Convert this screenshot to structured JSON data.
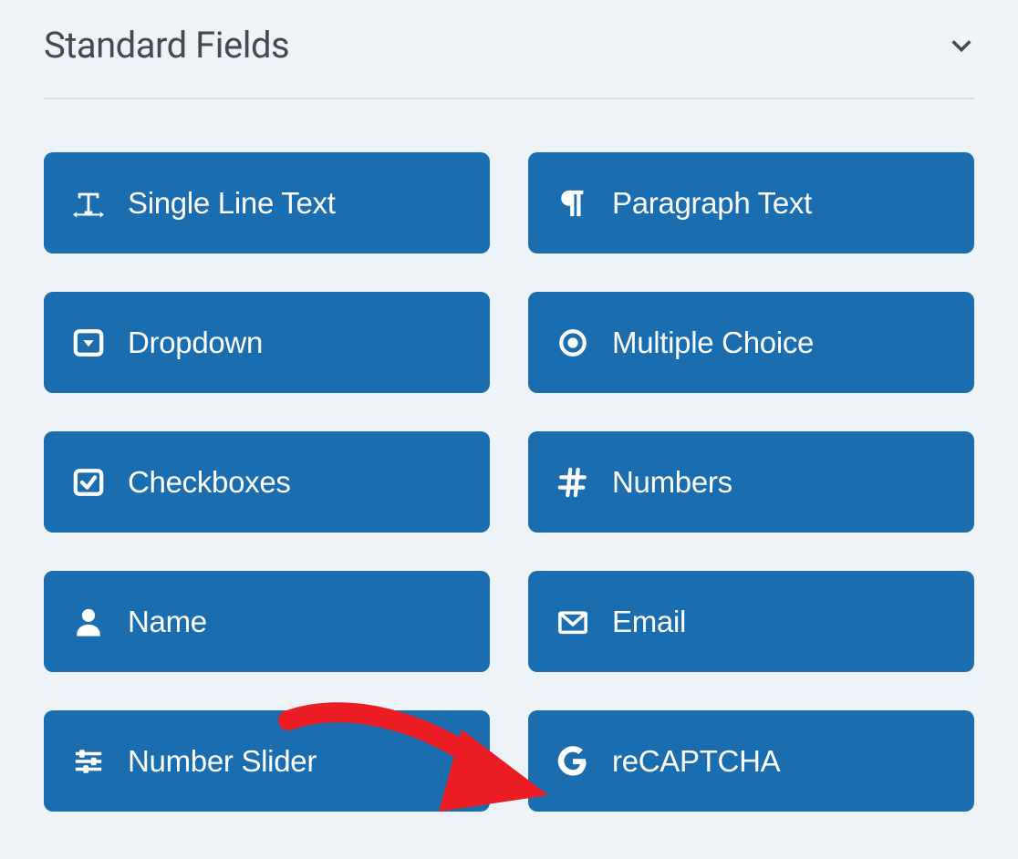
{
  "section": {
    "title": "Standard Fields"
  },
  "fields": [
    {
      "icon": "text-icon",
      "label": "Single Line Text"
    },
    {
      "icon": "paragraph-icon",
      "label": "Paragraph Text"
    },
    {
      "icon": "dropdown-icon",
      "label": "Dropdown"
    },
    {
      "icon": "radio-icon",
      "label": "Multiple Choice"
    },
    {
      "icon": "checkbox-icon",
      "label": "Checkboxes"
    },
    {
      "icon": "hash-icon",
      "label": "Numbers"
    },
    {
      "icon": "user-icon",
      "label": "Name"
    },
    {
      "icon": "envelope-icon",
      "label": "Email"
    },
    {
      "icon": "sliders-icon",
      "label": "Number Slider"
    },
    {
      "icon": "google-icon",
      "label": "reCAPTCHA"
    }
  ],
  "annotation": {
    "type": "arrow",
    "color": "#ec1c24",
    "target": "recaptcha-field-button"
  }
}
